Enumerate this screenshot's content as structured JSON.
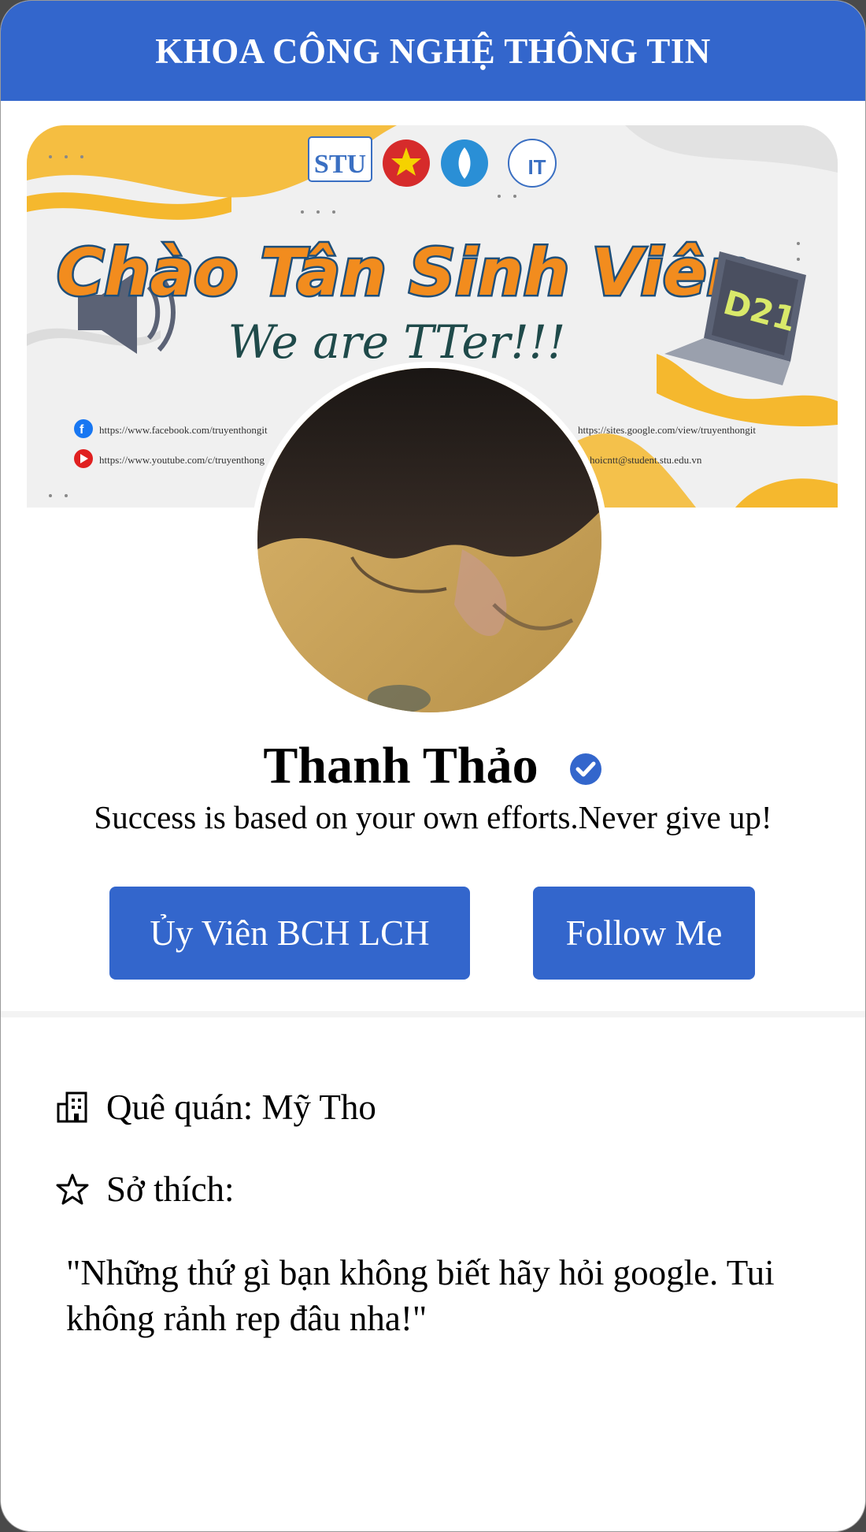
{
  "header": {
    "title": "KHOA CÔNG NGHỆ THÔNG TIN"
  },
  "banner": {
    "headline": "Chào Tân Sinh Viên",
    "subline": "We are TTer!!!",
    "badge": "D21",
    "logo_text": "STU",
    "logo_it": "IT",
    "facebook_url": "https://www.facebook.com/truyenthongit",
    "youtube_url": "https://www.youtube.com/c/truyenthong",
    "site_url": "https://sites.google.com/view/truyenthongit",
    "email": "hoicntt@student.stu.edu.vn",
    "colors": {
      "accent": "#f5b82e",
      "headline_fill": "#f28c1e",
      "headline_stroke": "#1f4f7a"
    }
  },
  "profile": {
    "name": "Thanh Thảo",
    "verified_icon": "verified-check-icon",
    "bio": "Success is based on your own efforts.Never give up!"
  },
  "actions": {
    "role_label": "Ủy Viên BCH LCH",
    "follow_label": "Follow Me"
  },
  "details": {
    "hometown_icon": "building-icon",
    "hometown_label": "Quê quán: Mỹ Tho",
    "hobby_icon": "star-icon",
    "hobby_label": "Sở thích:",
    "quote": "\"Những thứ gì bạn không biết hãy hỏi google. Tui không rảnh rep đâu nha!\""
  },
  "theme": {
    "primary": "#3366cc"
  }
}
